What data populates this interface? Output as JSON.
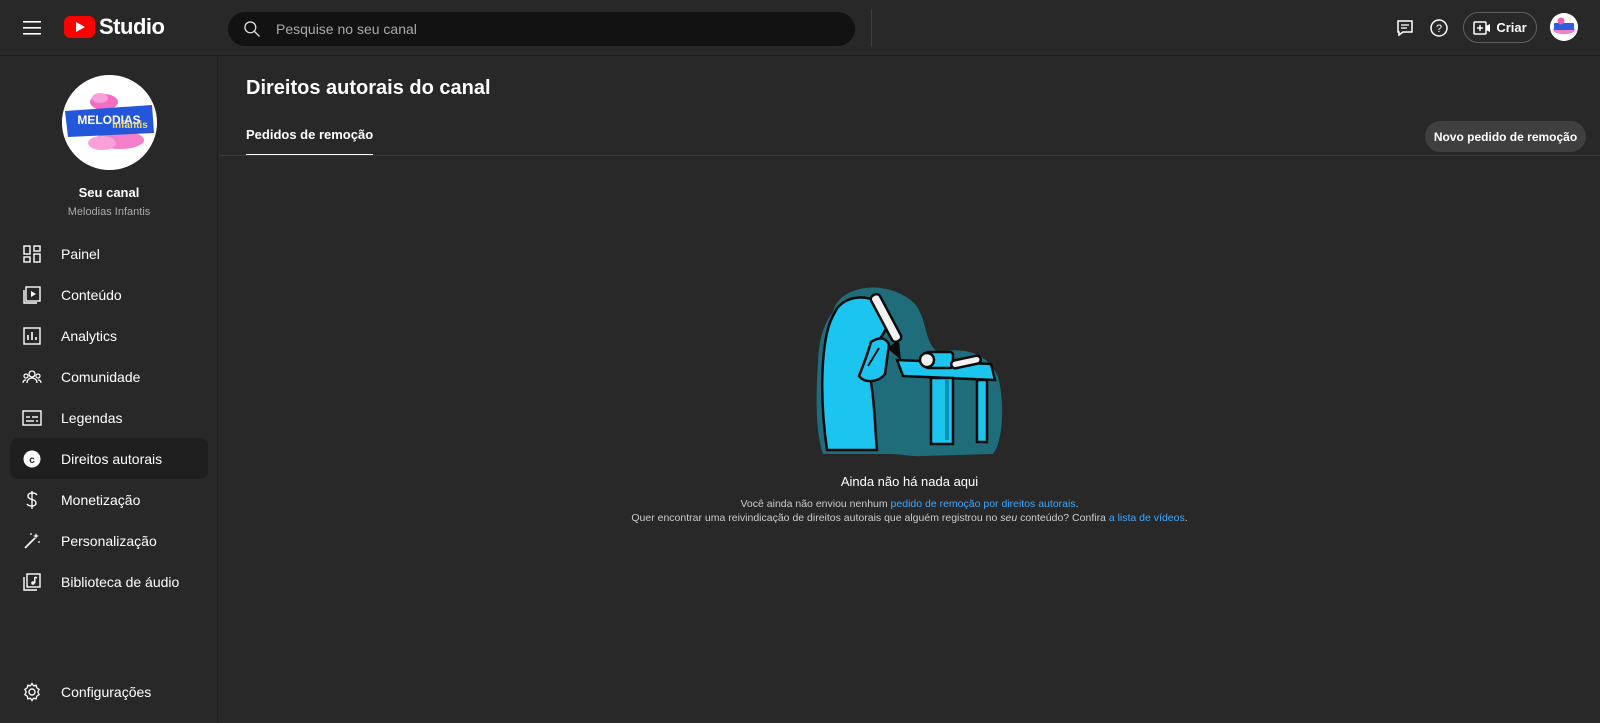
{
  "header": {
    "logo_text": "Studio",
    "search_placeholder": "Pesquise no seu canal",
    "create_label": "Criar",
    "brand_red": "#ff0000"
  },
  "sidebar": {
    "channel_title": "Seu canal",
    "channel_name": "Melodias Infantis",
    "channel_avatar_text": "MELODIAS Infantis",
    "items": [
      {
        "label": "Painel",
        "icon": "dashboard-icon"
      },
      {
        "label": "Conteúdo",
        "icon": "content-icon"
      },
      {
        "label": "Analytics",
        "icon": "analytics-icon"
      },
      {
        "label": "Comunidade",
        "icon": "community-icon"
      },
      {
        "label": "Legendas",
        "icon": "subtitles-icon"
      },
      {
        "label": "Direitos autorais",
        "icon": "copyright-icon",
        "active": true
      },
      {
        "label": "Monetização",
        "icon": "dollar-icon"
      },
      {
        "label": "Personalização",
        "icon": "magic-wand-icon"
      },
      {
        "label": "Biblioteca de áudio",
        "icon": "audio-library-icon"
      }
    ],
    "settings_label": "Configurações"
  },
  "main": {
    "page_title": "Direitos autorais do canal",
    "tab_label": "Pedidos de remoção",
    "new_request_label": "Novo pedido de remoção",
    "empty_title": "Ainda não há nada aqui",
    "line1_prefix": "Você ainda não enviou nenhum ",
    "line1_link": "pedido de remoção por direitos autorais",
    "line1_suffix": ".",
    "line2_prefix": "Quer encontrar uma reivindicação de direitos autorais que alguém registrou no ",
    "line2_em": "seu",
    "line2_mid": " conteúdo? Confira ",
    "line2_link": "a lista de vídeos",
    "line2_suffix": ".",
    "link_color": "#3ea6ff"
  }
}
